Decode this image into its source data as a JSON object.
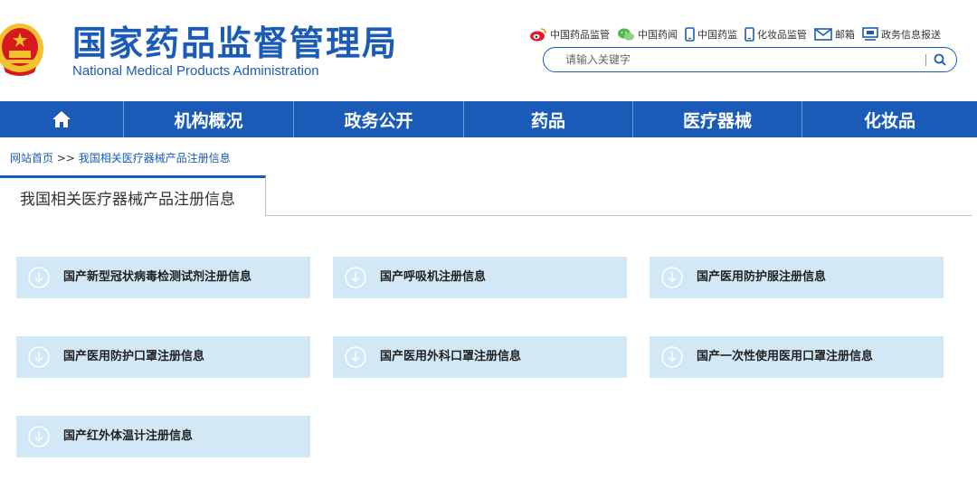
{
  "header": {
    "title_cn": "国家药品监督管理局",
    "title_en": "National Medical Products Administration",
    "emblem_icon": "national-emblem-icon",
    "toplinks": [
      {
        "label": "中国药品监管",
        "icon": "weibo-icon"
      },
      {
        "label": "中国药闻",
        "icon": "wechat-icon"
      },
      {
        "label": "中国药监",
        "icon": "mobile-icon"
      },
      {
        "label": "化妆品监管",
        "icon": "mobile-icon"
      },
      {
        "label": "邮箱",
        "icon": "mail-icon"
      },
      {
        "label": "政务信息报送",
        "icon": "monitor-icon"
      }
    ],
    "search": {
      "placeholder": "请输入关键字",
      "value": ""
    }
  },
  "nav": {
    "home_icon": "home-icon",
    "items": [
      "机构概况",
      "政务公开",
      "药品",
      "医疗器械",
      "化妆品"
    ]
  },
  "breadcrumb": {
    "home": "网站首页",
    "separator": ">>",
    "current": "我国相关医疗器械产品注册信息"
  },
  "tab": {
    "label": "我国相关医疗器械产品注册信息"
  },
  "cards": [
    {
      "label": "国产新型冠状病毒检测试剂注册信息",
      "icon": "download-icon"
    },
    {
      "label": "国产呼吸机注册信息",
      "icon": "download-icon"
    },
    {
      "label": "国产医用防护服注册信息",
      "icon": "download-icon"
    },
    {
      "label": "国产医用防护口罩注册信息",
      "icon": "download-icon"
    },
    {
      "label": "国产医用外科口罩注册信息",
      "icon": "download-icon"
    },
    {
      "label": "国产一次性使用医用口罩注册信息",
      "icon": "download-icon"
    },
    {
      "label": "国产红外体温计注册信息",
      "icon": "download-icon"
    }
  ],
  "colors": {
    "brand_blue": "#1a5bb8",
    "card_bg": "#d3e8f7",
    "emblem_red": "#d7191e",
    "emblem_gold": "#f2c12e"
  }
}
